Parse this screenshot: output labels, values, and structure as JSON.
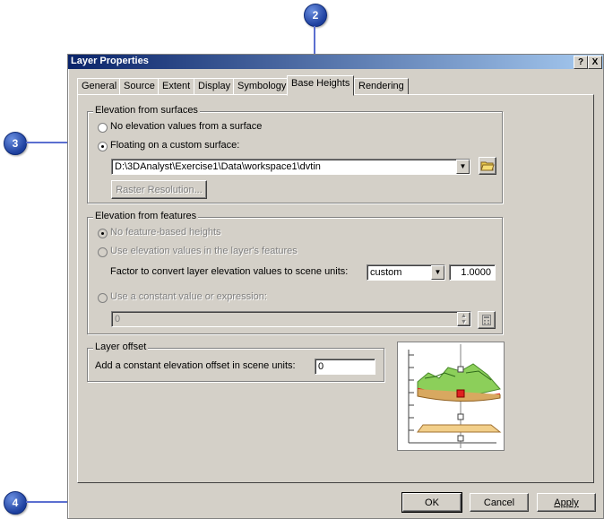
{
  "window": {
    "title": "Layer Properties",
    "help_btn": "?",
    "close_btn": "X"
  },
  "tabs": [
    {
      "label": "General"
    },
    {
      "label": "Source"
    },
    {
      "label": "Extent"
    },
    {
      "label": "Display"
    },
    {
      "label": "Symbology"
    },
    {
      "label": "Base Heights",
      "active": true
    },
    {
      "label": "Rendering"
    }
  ],
  "surfaces": {
    "legend": "Elevation from surfaces",
    "opt_none": "No elevation values from a surface",
    "opt_custom": "Floating on a custom surface:",
    "selected": "custom",
    "path": "D:\\3DAnalyst\\Exercise1\\Data\\workspace1\\dvtin",
    "raster_btn": "Raster Resolution..."
  },
  "features": {
    "legend": "Elevation from features",
    "opt_none": "No feature-based heights",
    "opt_use": "Use elevation values in the layer's features",
    "factor_label": "Factor to convert layer elevation values to scene units:",
    "factor_unit": "custom",
    "factor_value": "1.0000",
    "opt_const": "Use a constant value or expression:",
    "const_value": "0"
  },
  "offset": {
    "legend": "Layer offset",
    "label": "Add a constant elevation offset in scene units:",
    "value": "0"
  },
  "buttons": {
    "ok": "OK",
    "cancel": "Cancel",
    "apply": "Apply"
  },
  "callouts": {
    "c2": "2",
    "c3": "3",
    "c4": "4"
  },
  "colors": {
    "callout": "#1d3f9e",
    "leader": "#5b6fd0",
    "titlebar": "#0a246a",
    "dialog": "#d4d0c8"
  }
}
